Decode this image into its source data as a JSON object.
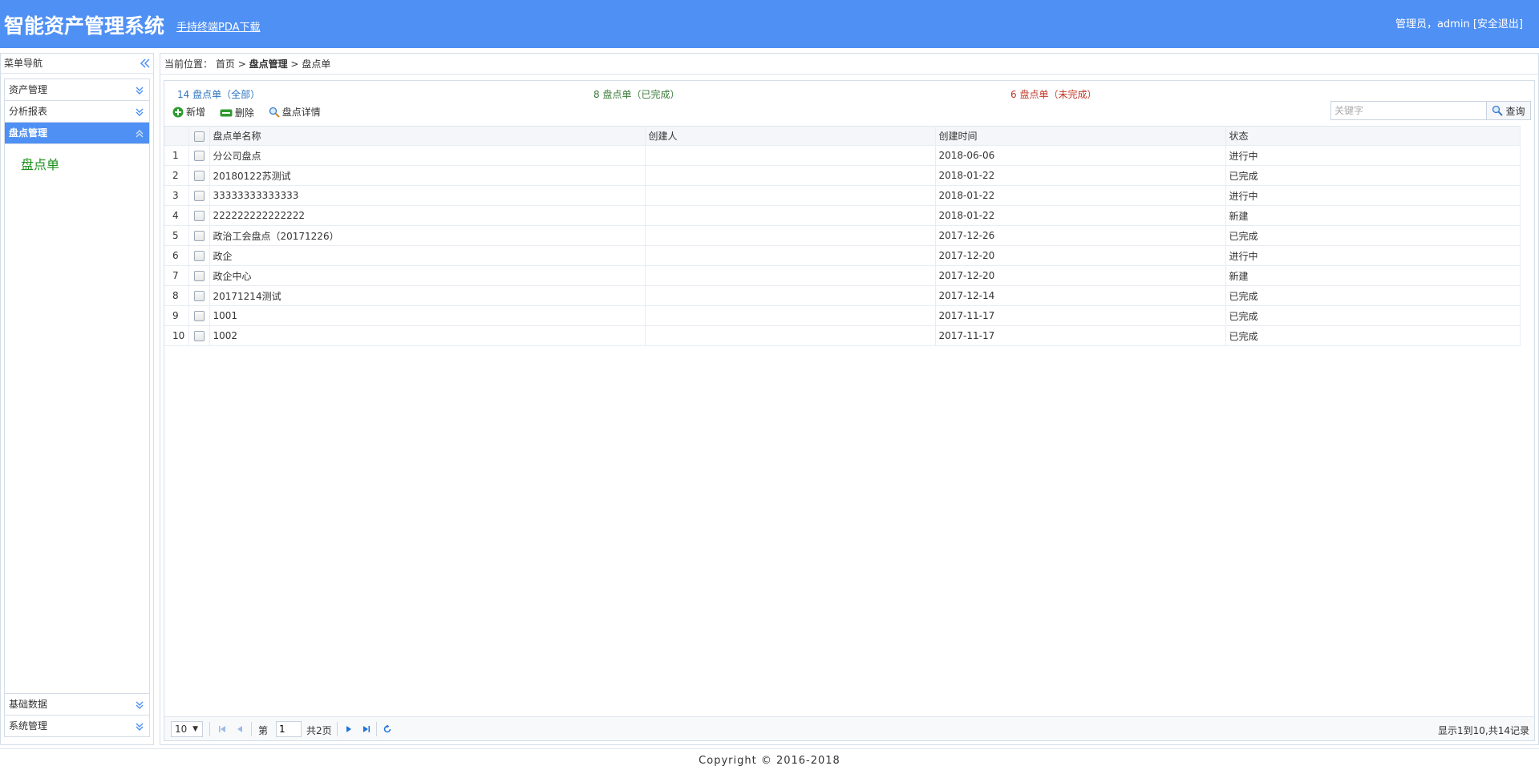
{
  "header": {
    "title": "智能资产管理系统",
    "pda_link": "手持终端PDA下载",
    "user_prefix": "管理员，admin",
    "logout": "[安全退出]",
    "bg_color": "#4f90f4"
  },
  "sidebar": {
    "title": "菜单导航",
    "collapse_icon": "double-chevron-left",
    "sections": [
      {
        "label": "资产管理",
        "expanded": false
      },
      {
        "label": "分析报表",
        "expanded": false
      },
      {
        "label": "盘点管理",
        "expanded": true,
        "items": [
          "盘点单"
        ]
      },
      {
        "label": "基础数据",
        "expanded": false
      },
      {
        "label": "系统管理",
        "expanded": false
      }
    ]
  },
  "breadcrumb": {
    "prefix": "当前位置：",
    "home": "首页",
    "sep": ">",
    "level1": "盘点管理",
    "level2": "盘点单"
  },
  "summary": {
    "all": "14 盘点单（全部）",
    "done": "8 盘点单（已完成）",
    "undone": "6 盘点单（未完成）",
    "colors": {
      "all": "#2e74c0",
      "done": "#3a7a3a",
      "undone": "#c0392b"
    }
  },
  "toolbar": {
    "add": "新增",
    "delete": "删除",
    "detail": "盘点详情"
  },
  "search": {
    "placeholder": "关键字",
    "button": "查询"
  },
  "table": {
    "columns": [
      "盘点单名称",
      "创建人",
      "创建时间",
      "状态"
    ],
    "rows": [
      {
        "num": "1",
        "name": "分公司盘点",
        "creator": "",
        "time": "2018-06-06",
        "status": "进行中"
      },
      {
        "num": "2",
        "name": "20180122苏测试",
        "creator": "",
        "time": "2018-01-22",
        "status": "已完成"
      },
      {
        "num": "3",
        "name": "33333333333333",
        "creator": "",
        "time": "2018-01-22",
        "status": "进行中"
      },
      {
        "num": "4",
        "name": "222222222222222",
        "creator": "",
        "time": "2018-01-22",
        "status": "新建"
      },
      {
        "num": "5",
        "name": "政治工会盘点（20171226）",
        "creator": "",
        "time": "2017-12-26",
        "status": "已完成"
      },
      {
        "num": "6",
        "name": "政企",
        "creator": "",
        "time": "2017-12-20",
        "status": "进行中"
      },
      {
        "num": "7",
        "name": "政企中心",
        "creator": "",
        "time": "2017-12-20",
        "status": "新建"
      },
      {
        "num": "8",
        "name": "20171214测试",
        "creator": "",
        "time": "2017-12-14",
        "status": "已完成"
      },
      {
        "num": "9",
        "name": "1001",
        "creator": "",
        "time": "2017-11-17",
        "status": "已完成"
      },
      {
        "num": "10",
        "name": "1002",
        "creator": "",
        "time": "2017-11-17",
        "status": "已完成"
      }
    ]
  },
  "pager": {
    "page_size": "10",
    "page_prefix": "第",
    "page_value": "1",
    "page_total": "共2页",
    "info": "显示1到10,共14记录"
  },
  "footer": {
    "copyright": "Copyright © 2016-2018"
  }
}
